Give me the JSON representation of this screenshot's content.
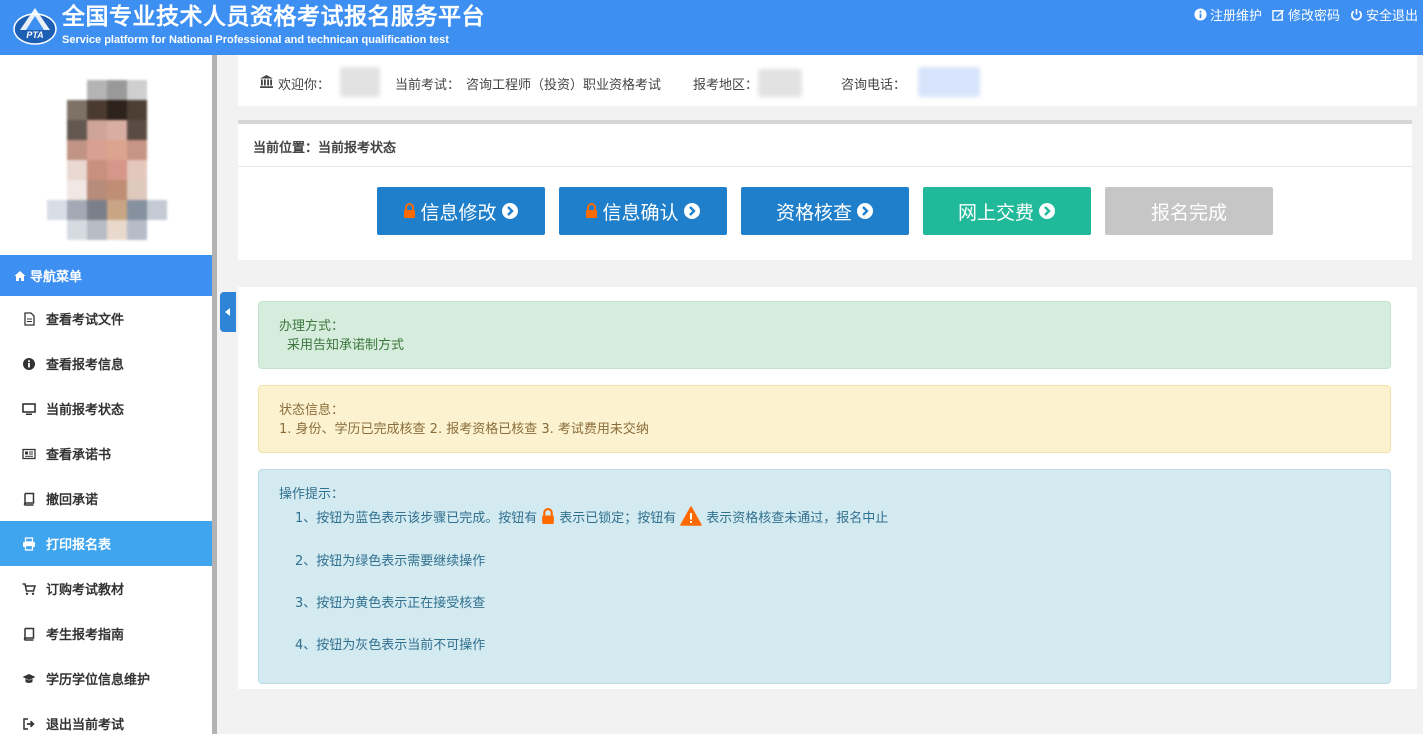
{
  "header": {
    "logo_text": "PTA",
    "title": "全国专业技术人员资格考试报名服务平台",
    "subtitle": "Service platform for National Professional and technican qualification test",
    "links": [
      {
        "label": "注册维护",
        "icon": "info-circle-icon"
      },
      {
        "label": "修改密码",
        "icon": "edit-icon"
      },
      {
        "label": "安全退出",
        "icon": "power-icon"
      }
    ]
  },
  "sidebar": {
    "nav_header": "导航菜单",
    "items": [
      {
        "label": "查看考试文件",
        "icon": "file-text-icon",
        "active": false
      },
      {
        "label": "查看报考信息",
        "icon": "info-circle-icon",
        "active": false
      },
      {
        "label": "当前报考状态",
        "icon": "monitor-icon",
        "active": false
      },
      {
        "label": "查看承诺书",
        "icon": "newspaper-icon",
        "active": false
      },
      {
        "label": "撤回承诺",
        "icon": "book-icon",
        "active": false
      },
      {
        "label": "打印报名表",
        "icon": "printer-icon",
        "active": true
      },
      {
        "label": "订购考试教材",
        "icon": "cart-icon",
        "active": false
      },
      {
        "label": "考生报考指南",
        "icon": "book-icon",
        "active": false
      },
      {
        "label": "学历学位信息维护",
        "icon": "graduation-cap-icon",
        "active": false
      },
      {
        "label": "退出当前考试",
        "icon": "sign-out-icon",
        "active": false
      }
    ]
  },
  "info_bar": {
    "welcome_label": "欢迎你：",
    "exam_label": "当前考试：",
    "exam_value": "咨询工程师（投资）职业资格考试",
    "region_label": "报考地区：",
    "phone_label": "咨询电话："
  },
  "status": {
    "location": "当前位置：当前报考状态",
    "steps": [
      {
        "label": "信息修改",
        "locked": true,
        "style": "blue"
      },
      {
        "label": "信息确认",
        "locked": true,
        "style": "blue"
      },
      {
        "label": "资格核查",
        "locked": false,
        "style": "blue"
      },
      {
        "label": "网上交费",
        "locked": false,
        "style": "green"
      },
      {
        "label": "报名完成",
        "locked": false,
        "style": "gray"
      }
    ]
  },
  "alerts": {
    "method_title": "办理方式：",
    "method_text": "采用告知承诺制方式",
    "status_title": "状态信息：",
    "status_text": "1. 身份、学历已完成核查 2. 报考资格已核查 3. 考试费用未交纳",
    "tips_title": "操作提示：",
    "tip1_a": "1、按钮为蓝色表示该步骤已完成。按钮有",
    "tip1_b": "表示已锁定；按钮有",
    "tip1_c": "表示资格核查未通过，报名中止",
    "tip2": "2、按钮为绿色表示需要继续操作",
    "tip3": "3、按钮为黄色表示正在接受核查",
    "tip4": "4、按钮为灰色表示当前不可操作"
  },
  "colors": {
    "header": "#3d8ff2",
    "step_blue": "#1f7fca",
    "step_green": "#20b999",
    "step_gray": "#c6c6c6",
    "active_nav": "#3fa5ee",
    "lock": "#ff6a00"
  }
}
